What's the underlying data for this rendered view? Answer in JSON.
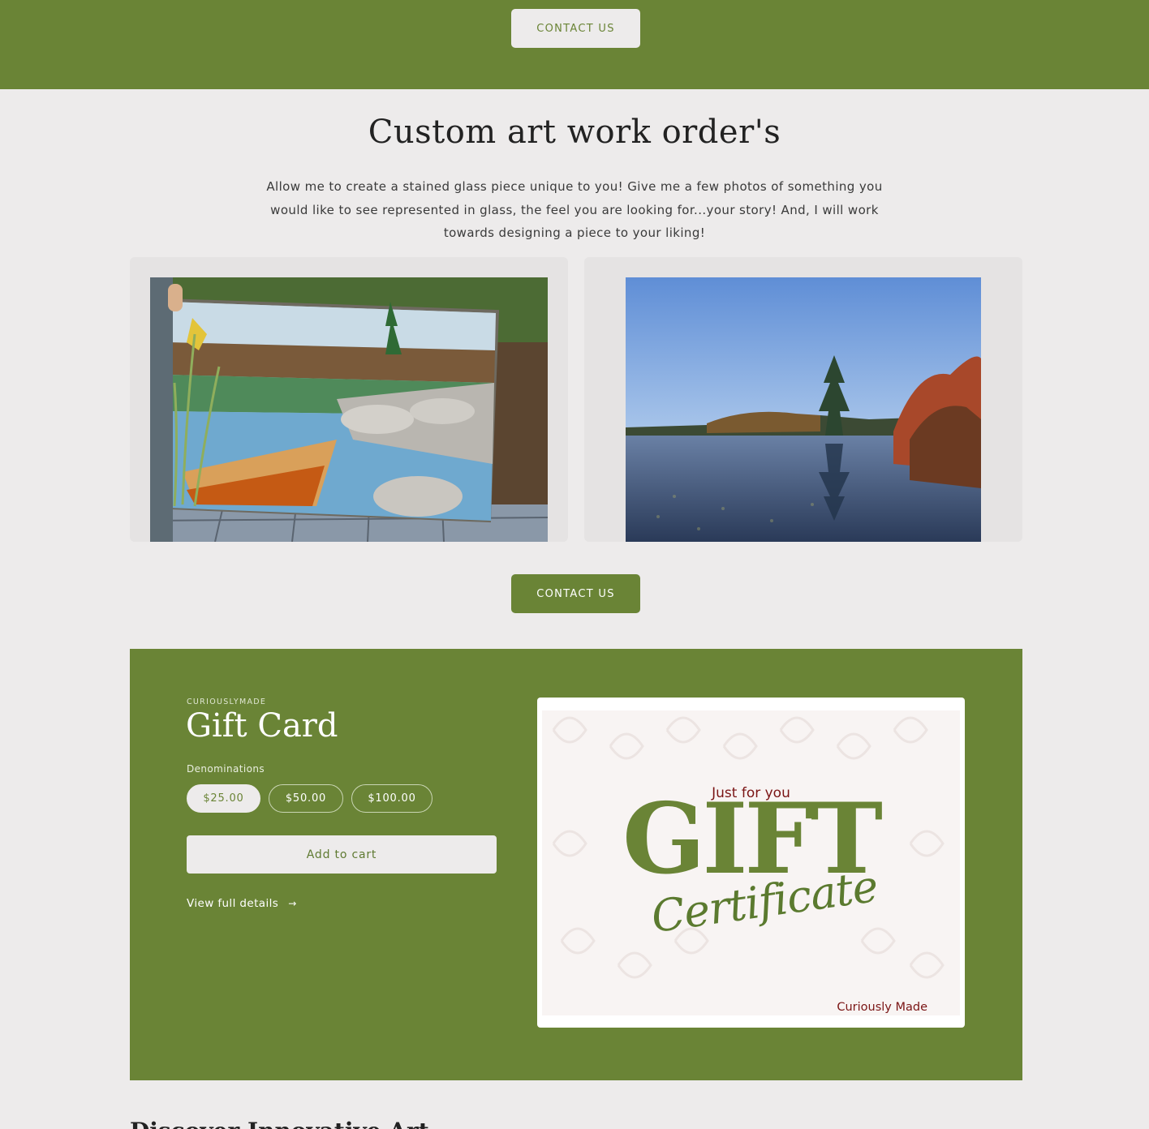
{
  "colors": {
    "brand_green": "#6a8436",
    "background": "#edebeb",
    "accent_red": "#7a1414"
  },
  "top_band": {
    "contact_label": "CONTACT US"
  },
  "custom_section": {
    "title": "Custom art work order's",
    "description": "Allow me to create a stained glass piece unique to you! Give me a few photos of something you would like to see represented in glass, the feel you are looking for...your story! And, I will work towards designing a piece to your liking!",
    "contact_label": "CONTACT US"
  },
  "gift_card": {
    "vendor": "CURIOUSLYMADE",
    "title": "Gift Card",
    "denominations_label": "Denominations",
    "denominations": [
      "$25.00",
      "$50.00",
      "$100.00"
    ],
    "selected_denomination": "$25.00",
    "add_to_cart_label": "Add to cart",
    "view_details_label": "View full details",
    "image": {
      "tagline": "Just for you",
      "headline": "GIFT",
      "subheadline": "Certificate",
      "signature": "Curiously Made"
    }
  },
  "next_section": {
    "heading": "Discover Innovative Art"
  }
}
